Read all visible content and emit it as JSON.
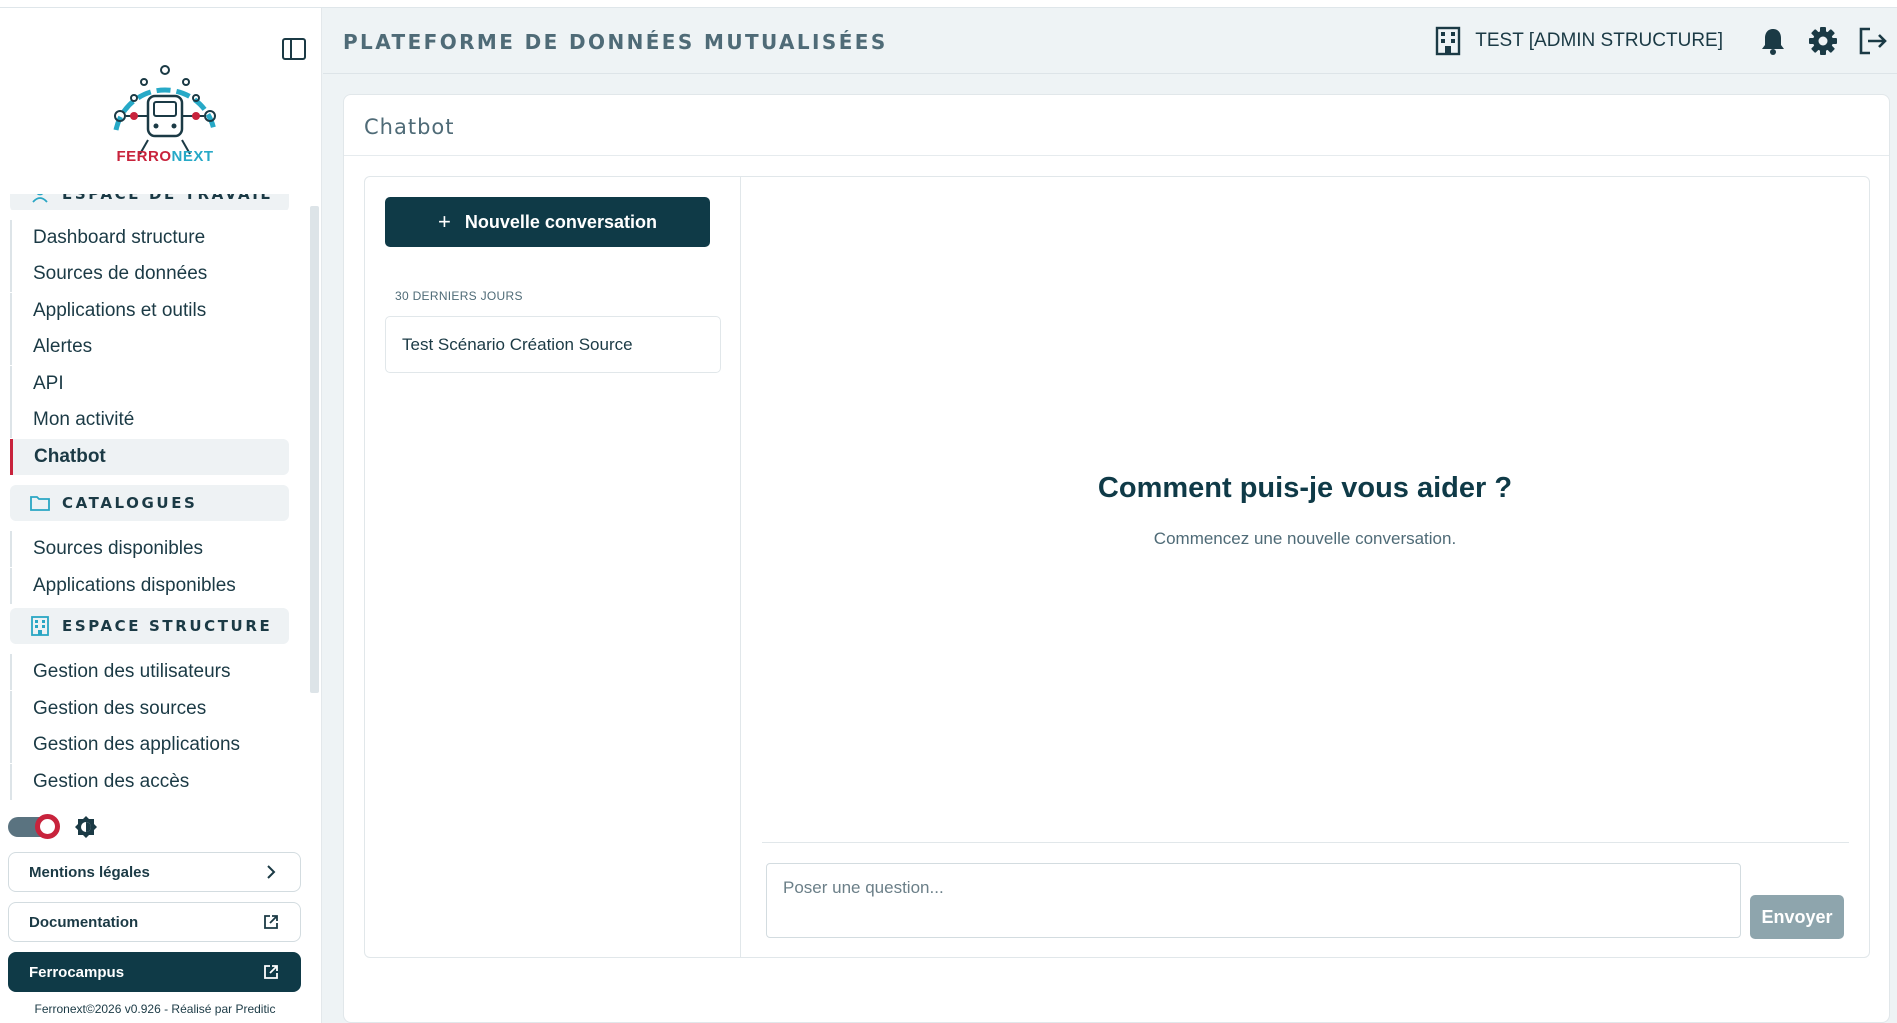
{
  "sidebar": {
    "logo": {
      "text_a": "FERRO",
      "text_b": "NEXT"
    },
    "sections": [
      {
        "label": "ESPACE DE TRAVAIL",
        "icon": "user-icon"
      },
      {
        "label": "CATALOGUES",
        "icon": "folder-icon"
      },
      {
        "label": "ESPACE STRUCTURE",
        "icon": "building-icon"
      }
    ],
    "workspace_items": [
      "Dashboard structure",
      "Sources de données",
      "Applications et outils",
      "Alertes",
      "API",
      "Mon activité",
      "Chatbot"
    ],
    "catalog_items": [
      "Sources disponibles",
      "Applications disponibles"
    ],
    "structure_items": [
      "Gestion des utilisateurs",
      "Gestion des sources",
      "Gestion des applications",
      "Gestion des accès"
    ],
    "links": {
      "legal": "Mentions légales",
      "docs": "Documentation",
      "campus": "Ferrocampus"
    },
    "footer": "Ferronext©2026 v0.926 - Réalisé par Preditic"
  },
  "header": {
    "title": "PLATEFORME DE DONNÉES MUTUALISÉES",
    "user": "TEST [ADMIN STRUCTURE]"
  },
  "main": {
    "title": "Chatbot",
    "new_conversation": "Nouvelle conversation",
    "group_label": "30 DERNIERS JOURS",
    "conversations": [
      "Test Scénario Création Source"
    ],
    "empty_title": "Comment puis-je vous aider ?",
    "empty_subtitle": "Commencez une nouvelle conversation.",
    "input_placeholder": "Poser une question...",
    "send_label": "Envoyer"
  },
  "colors": {
    "primary": "#0f3a47",
    "accent_red": "#c8233c",
    "accent_cyan": "#2aa6c4"
  }
}
